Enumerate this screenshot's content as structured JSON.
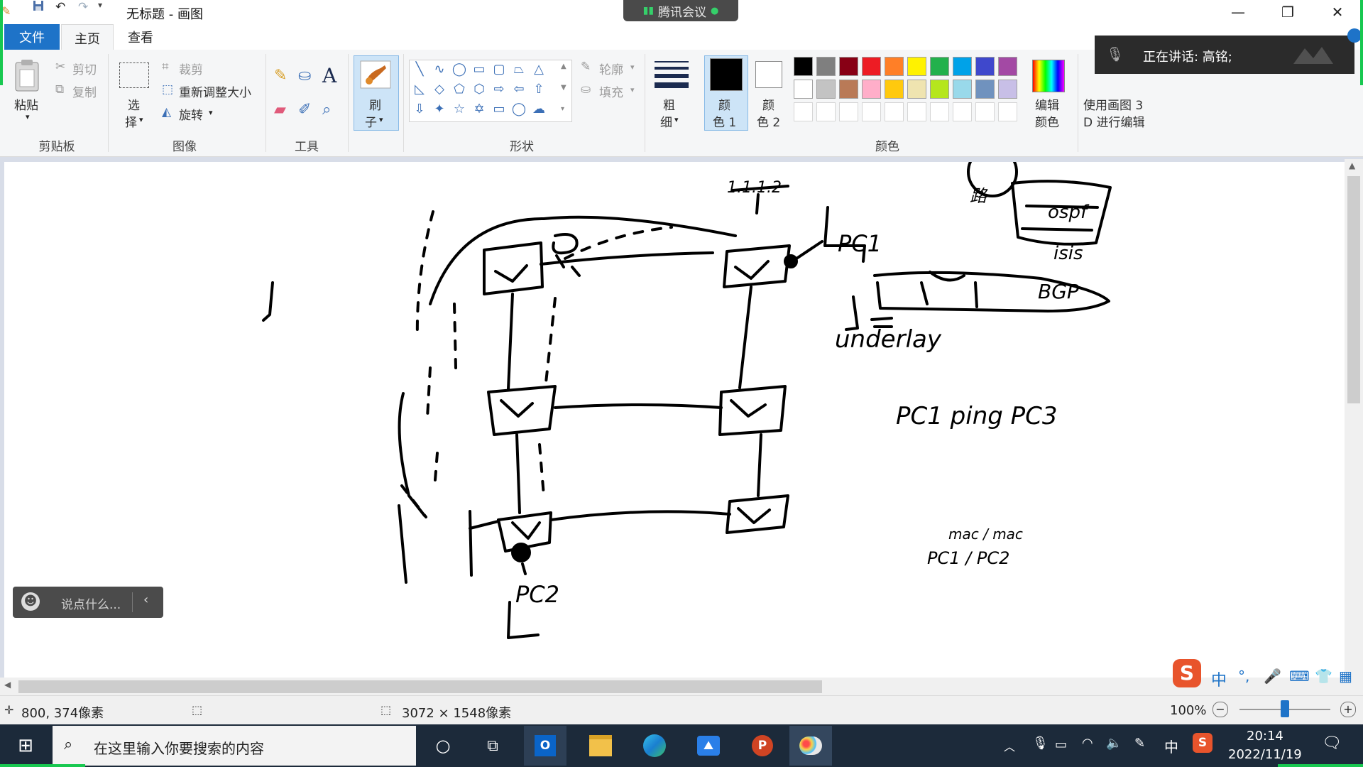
{
  "titlebar": {
    "title": "无标题 - 画图",
    "meeting_label": "腾讯会议"
  },
  "tabs": [
    "文件",
    "主页",
    "查看"
  ],
  "ribbon": {
    "clipboard": {
      "paste": "粘贴",
      "cut": "剪切",
      "copy": "复制",
      "group": "剪贴板"
    },
    "image": {
      "select": "选\n择",
      "select_l1": "选",
      "select_l2": "择",
      "crop": "裁剪",
      "resize": "重新调整大小",
      "rotate": "旋转",
      "group": "图像"
    },
    "tools": {
      "group": "工具"
    },
    "brush": {
      "l1": "刷",
      "l2": "子"
    },
    "shapes": {
      "outline": "轮廓",
      "fill": "填充",
      "group": "形状"
    },
    "size": {
      "l1": "粗",
      "l2": "细"
    },
    "color1": {
      "l1": "颜",
      "l2": "色 1"
    },
    "color2": {
      "l1": "颜",
      "l2": "色 2"
    },
    "colors_group": "颜色",
    "edit_colors": {
      "l1": "编辑",
      "l2": "颜色"
    },
    "paint3d": {
      "l1": "使用画图 3",
      "l2": "D 进行编辑"
    },
    "palette_row1": [
      "#000000",
      "#7f7f7f",
      "#880015",
      "#ed1c24",
      "#ff7f27",
      "#fff200",
      "#22b14c",
      "#00a2e8",
      "#3f48cc",
      "#a349a4"
    ],
    "palette_row2": [
      "#ffffff",
      "#c3c3c3",
      "#b97a57",
      "#ffaec9",
      "#ffc90e",
      "#efe4b0",
      "#b5e61d",
      "#99d9ea",
      "#7092be",
      "#c8bfe7"
    ]
  },
  "sketch_text": {
    "ip": "1.1.1.2",
    "pc1": "PC1",
    "pc2": "PC2",
    "ospf": "ospf",
    "isis": "isis",
    "bgp": "BGP",
    "underlay": "underlay",
    "ping": "PC1 ping PC3",
    "mac": "mac / mac",
    "pcs": "PC1 / PC2",
    "circle": "路"
  },
  "status": {
    "cursor_pos": "800, 374像素",
    "canvas_size": "3072 × 1548像素",
    "zoom": "100%"
  },
  "speaking": {
    "text": "正在讲话: 高铭;"
  },
  "chat": {
    "placeholder": "说点什么..."
  },
  "ime": {
    "lang": "中"
  },
  "taskbar": {
    "search_placeholder": "在这里输入你要搜索的内容",
    "lang": "中",
    "time": "20:14",
    "date": "2022/11/19"
  }
}
